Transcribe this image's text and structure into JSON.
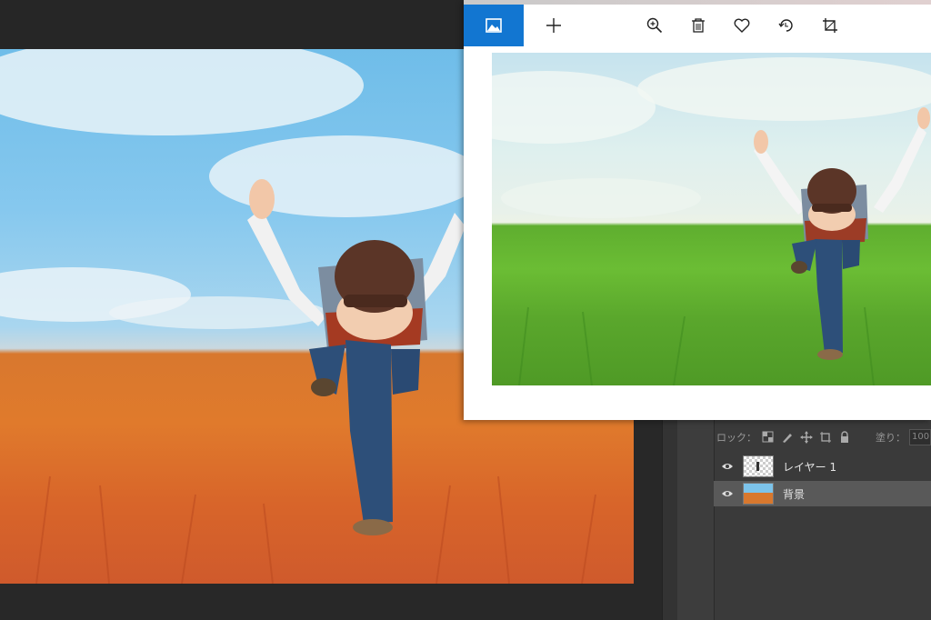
{
  "photoshop": {
    "lock_label": "ロック：",
    "fill_label": "塗り：",
    "fill_value": "100",
    "layers": [
      {
        "name": "レイヤー 1",
        "thumbnail": "transparent-checker",
        "visible": true,
        "selected": false
      },
      {
        "name": "背景",
        "thumbnail": "orange-field-photo",
        "visible": true,
        "selected": true
      }
    ],
    "lock_icons": [
      "lock-transparent-pixels-icon",
      "lock-image-pixels-icon",
      "lock-position-icon",
      "lock-artboard-icon",
      "lock-all-icon"
    ]
  },
  "viewer": {
    "toolbar_icons": [
      "image-icon",
      "add-icon",
      "zoom-in-icon",
      "delete-icon",
      "favorite-icon",
      "rotate-icon",
      "crop-icon"
    ],
    "accent_color": "#1276d1"
  },
  "colors": {
    "ps_background": "#262626",
    "ps_panel": "#3a3a3a",
    "selected_layer": "#595959"
  }
}
